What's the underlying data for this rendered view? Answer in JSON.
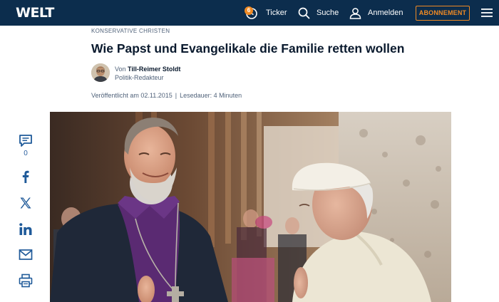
{
  "header": {
    "logo": "WELT",
    "ticker_badge": "6",
    "ticker_label": "Ticker",
    "search_label": "Suche",
    "login_label": "Anmelden",
    "subscription_label": "ABONNEMENT",
    "colors": {
      "header_bg": "#0c2d4d",
      "accent": "#f08a24"
    }
  },
  "article": {
    "kicker": "KONSERVATIVE CHRISTEN",
    "headline": "Wie Papst und Evangelikale die Familie retten wollen",
    "byline_prefix": "Von",
    "author": "Till-Reimer Stoldt",
    "role": "Politik-Redakteur",
    "published": "Veröffentlicht am 02.11.2015",
    "separator": "|",
    "reading_time": "Lesedauer: 4 Minuten"
  },
  "share": {
    "comment_count": "0",
    "icons": [
      "comment-icon",
      "facebook-icon",
      "x-icon",
      "linkedin-icon",
      "mail-icon",
      "print-icon"
    ]
  }
}
